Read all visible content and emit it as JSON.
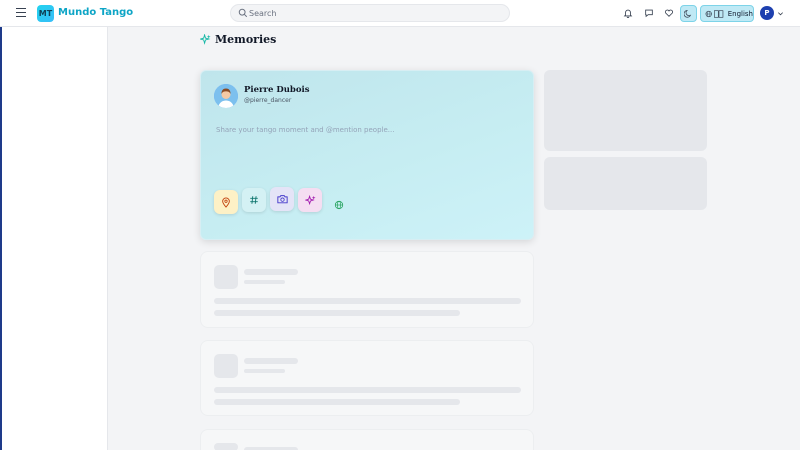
{
  "header": {
    "logo_text": "MT",
    "brand_name": "Mundo Tango",
    "search_placeholder": "Search",
    "language_label": "English",
    "user_initial": "P",
    "icons": [
      "menu-icon",
      "search-icon",
      "bell-icon",
      "message-icon",
      "heart-icon",
      "moon-icon",
      "globe-icon",
      "translate-icon",
      "chevron-down-icon"
    ]
  },
  "page": {
    "title": "Memories",
    "title_icon": "sparkles-icon"
  },
  "composer": {
    "user_name": "Pierre Dubois",
    "user_handle": "@pierre_dancer",
    "placeholder": "Share your tango moment and @mention people...",
    "tools": [
      {
        "name": "location",
        "icon": "map-pin-icon"
      },
      {
        "name": "hashtag",
        "icon": "hash-icon"
      },
      {
        "name": "photo",
        "icon": "camera-icon"
      },
      {
        "name": "ai",
        "icon": "sparkles-icon"
      },
      {
        "name": "visibility",
        "icon": "globe-icon"
      }
    ]
  },
  "colors": {
    "accent": "#0ea5c6",
    "composer_bg": "#c6edf2",
    "skeleton": "#e5e7eb"
  }
}
